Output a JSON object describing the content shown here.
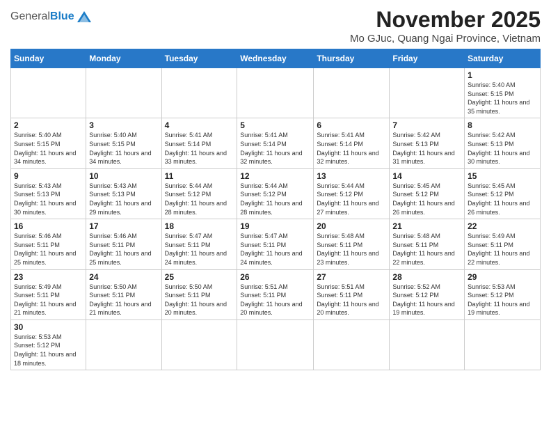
{
  "header": {
    "logo_general": "General",
    "logo_blue": "Blue",
    "month_title": "November 2025",
    "location": "Mo GJuc, Quang Ngai Province, Vietnam"
  },
  "weekdays": [
    "Sunday",
    "Monday",
    "Tuesday",
    "Wednesday",
    "Thursday",
    "Friday",
    "Saturday"
  ],
  "days": {
    "d1": {
      "num": "1",
      "sunrise": "5:40 AM",
      "sunset": "5:15 PM",
      "daylight": "11 hours and 35 minutes."
    },
    "d2": {
      "num": "2",
      "sunrise": "5:40 AM",
      "sunset": "5:15 PM",
      "daylight": "11 hours and 34 minutes."
    },
    "d3": {
      "num": "3",
      "sunrise": "5:40 AM",
      "sunset": "5:15 PM",
      "daylight": "11 hours and 34 minutes."
    },
    "d4": {
      "num": "4",
      "sunrise": "5:41 AM",
      "sunset": "5:14 PM",
      "daylight": "11 hours and 33 minutes."
    },
    "d5": {
      "num": "5",
      "sunrise": "5:41 AM",
      "sunset": "5:14 PM",
      "daylight": "11 hours and 32 minutes."
    },
    "d6": {
      "num": "6",
      "sunrise": "5:41 AM",
      "sunset": "5:14 PM",
      "daylight": "11 hours and 32 minutes."
    },
    "d7": {
      "num": "7",
      "sunrise": "5:42 AM",
      "sunset": "5:13 PM",
      "daylight": "11 hours and 31 minutes."
    },
    "d8": {
      "num": "8",
      "sunrise": "5:42 AM",
      "sunset": "5:13 PM",
      "daylight": "11 hours and 30 minutes."
    },
    "d9": {
      "num": "9",
      "sunrise": "5:43 AM",
      "sunset": "5:13 PM",
      "daylight": "11 hours and 30 minutes."
    },
    "d10": {
      "num": "10",
      "sunrise": "5:43 AM",
      "sunset": "5:13 PM",
      "daylight": "11 hours and 29 minutes."
    },
    "d11": {
      "num": "11",
      "sunrise": "5:44 AM",
      "sunset": "5:12 PM",
      "daylight": "11 hours and 28 minutes."
    },
    "d12": {
      "num": "12",
      "sunrise": "5:44 AM",
      "sunset": "5:12 PM",
      "daylight": "11 hours and 28 minutes."
    },
    "d13": {
      "num": "13",
      "sunrise": "5:44 AM",
      "sunset": "5:12 PM",
      "daylight": "11 hours and 27 minutes."
    },
    "d14": {
      "num": "14",
      "sunrise": "5:45 AM",
      "sunset": "5:12 PM",
      "daylight": "11 hours and 26 minutes."
    },
    "d15": {
      "num": "15",
      "sunrise": "5:45 AM",
      "sunset": "5:12 PM",
      "daylight": "11 hours and 26 minutes."
    },
    "d16": {
      "num": "16",
      "sunrise": "5:46 AM",
      "sunset": "5:11 PM",
      "daylight": "11 hours and 25 minutes."
    },
    "d17": {
      "num": "17",
      "sunrise": "5:46 AM",
      "sunset": "5:11 PM",
      "daylight": "11 hours and 25 minutes."
    },
    "d18": {
      "num": "18",
      "sunrise": "5:47 AM",
      "sunset": "5:11 PM",
      "daylight": "11 hours and 24 minutes."
    },
    "d19": {
      "num": "19",
      "sunrise": "5:47 AM",
      "sunset": "5:11 PM",
      "daylight": "11 hours and 24 minutes."
    },
    "d20": {
      "num": "20",
      "sunrise": "5:48 AM",
      "sunset": "5:11 PM",
      "daylight": "11 hours and 23 minutes."
    },
    "d21": {
      "num": "21",
      "sunrise": "5:48 AM",
      "sunset": "5:11 PM",
      "daylight": "11 hours and 22 minutes."
    },
    "d22": {
      "num": "22",
      "sunrise": "5:49 AM",
      "sunset": "5:11 PM",
      "daylight": "11 hours and 22 minutes."
    },
    "d23": {
      "num": "23",
      "sunrise": "5:49 AM",
      "sunset": "5:11 PM",
      "daylight": "11 hours and 21 minutes."
    },
    "d24": {
      "num": "24",
      "sunrise": "5:50 AM",
      "sunset": "5:11 PM",
      "daylight": "11 hours and 21 minutes."
    },
    "d25": {
      "num": "25",
      "sunrise": "5:50 AM",
      "sunset": "5:11 PM",
      "daylight": "11 hours and 20 minutes."
    },
    "d26": {
      "num": "26",
      "sunrise": "5:51 AM",
      "sunset": "5:11 PM",
      "daylight": "11 hours and 20 minutes."
    },
    "d27": {
      "num": "27",
      "sunrise": "5:51 AM",
      "sunset": "5:11 PM",
      "daylight": "11 hours and 20 minutes."
    },
    "d28": {
      "num": "28",
      "sunrise": "5:52 AM",
      "sunset": "5:12 PM",
      "daylight": "11 hours and 19 minutes."
    },
    "d29": {
      "num": "29",
      "sunrise": "5:53 AM",
      "sunset": "5:12 PM",
      "daylight": "11 hours and 19 minutes."
    },
    "d30": {
      "num": "30",
      "sunrise": "5:53 AM",
      "sunset": "5:12 PM",
      "daylight": "11 hours and 18 minutes."
    }
  }
}
